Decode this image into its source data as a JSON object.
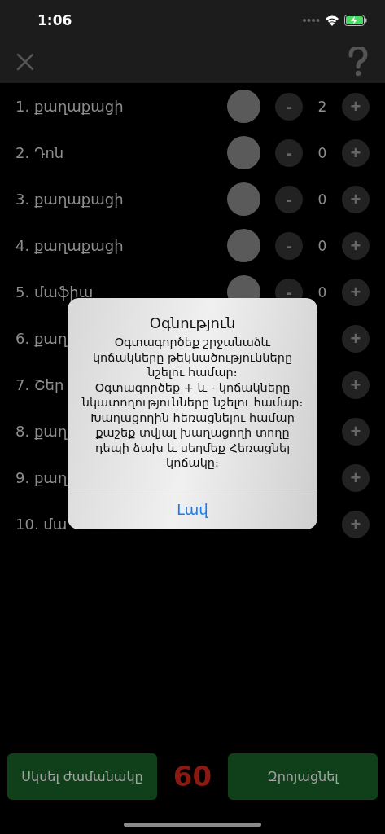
{
  "status_bar": {
    "time": "1:06"
  },
  "rows": [
    {
      "name": "1. քաղաքացի",
      "count": "2"
    },
    {
      "name": "2. Դոն",
      "count": "0"
    },
    {
      "name": "3. քաղաքացի",
      "count": "0"
    },
    {
      "name": "4. քաղաքացի",
      "count": "0"
    },
    {
      "name": "5. մաֆիա",
      "count": "0"
    },
    {
      "name": "6. քաղ"
    },
    {
      "name": "7. Շեր"
    },
    {
      "name": "8. քաղ"
    },
    {
      "name": "9. քաղ"
    },
    {
      "name": "10. մա"
    }
  ],
  "minus_label": "-",
  "plus_label": "+",
  "dialog": {
    "title": "Օգնություն",
    "paragraphs": [
      "Օգտագործեք շրջանաձև կոճակները թեկնածությունները նշելու համար։",
      "Օգտագործեք + և - կոճակները նկատողությունները նշելու համար։",
      "Խաղացողին հեռացնելու համար քաշեք տվյալ խաղացողի տողը դեպի ձախ և սեղմեք Հեռացնել կոճակը։"
    ],
    "button": "Լավ"
  },
  "footer": {
    "start_button": "Սկսել ժամանակը",
    "timer": "60",
    "reset_button": "Զրոյացնել"
  }
}
